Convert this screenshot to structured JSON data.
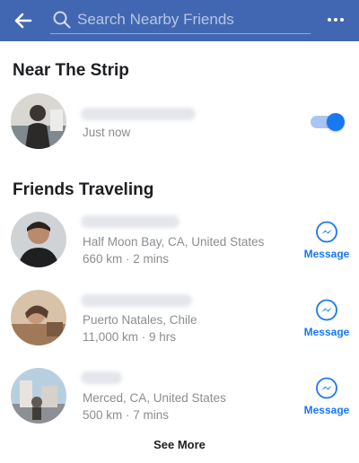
{
  "header": {
    "search_placeholder": "Search Nearby Friends",
    "accent_color": "#4267b2",
    "icons": [
      "back-arrow-icon",
      "search-icon",
      "more-options-icon"
    ]
  },
  "near": {
    "title": "Near The Strip",
    "friend": {
      "time": "Just now",
      "sharing_enabled": true
    }
  },
  "traveling": {
    "title": "Friends Traveling",
    "friends": [
      {
        "location": "Half Moon Bay, CA, United States",
        "meta": "660 km · 2 mins",
        "action": "Message"
      },
      {
        "location": "Puerto Natales, Chile",
        "meta": "11,000 km · 9 hrs",
        "action": "Message"
      },
      {
        "location": "Merced, CA, United States",
        "meta": "500 km · 7 mins",
        "action": "Message"
      }
    ]
  },
  "footer": {
    "see_more": "See More"
  },
  "colors": {
    "messenger_blue": "#1877f2",
    "secondary_text": "#8a8d91"
  }
}
